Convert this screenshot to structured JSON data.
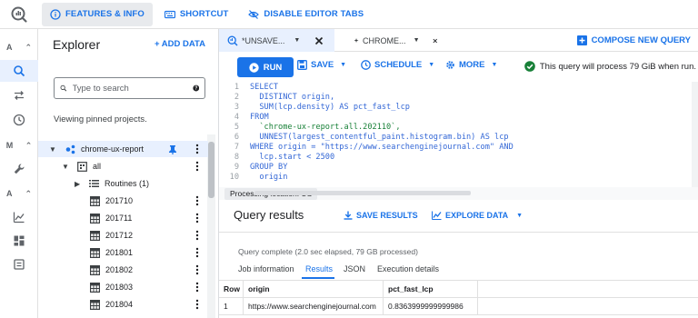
{
  "topbar": {
    "features_label": "FEATURES & INFO",
    "shortcut_label": "SHORTCUT",
    "disable_tabs_label": "DISABLE EDITOR TABS"
  },
  "rail": {
    "rows": [
      {
        "letter": "A",
        "chevron": "^"
      },
      {
        "letter": "M",
        "chevron": "^"
      },
      {
        "letter": "A",
        "chevron": "^"
      }
    ]
  },
  "explorer": {
    "title": "Explorer",
    "add_data_label": "+ ADD DATA",
    "search_placeholder": "Type to search",
    "pinned_text": "Viewing pinned projects.",
    "project": "chrome-ux-report",
    "dataset": "all",
    "routines": "Routines (1)",
    "tables": [
      "201710",
      "201711",
      "201712",
      "201801",
      "201802",
      "201803",
      "201804"
    ]
  },
  "tabs": {
    "tab1_label": "*UNSAVE...",
    "tab2_label": "CHROME...",
    "compose_label": "COMPOSE NEW QUERY"
  },
  "toolbar": {
    "run_label": "RUN",
    "save_label": "SAVE",
    "schedule_label": "SCHEDULE",
    "more_label": "MORE",
    "process_message": "This query will process 79 GiB when run."
  },
  "editor": {
    "lines": [
      {
        "n": "1",
        "text": "SELECT"
      },
      {
        "n": "2",
        "text": "  DISTINCT origin,"
      },
      {
        "n": "3",
        "text": "  SUM(lcp.density) AS pct_fast_lcp"
      },
      {
        "n": "4",
        "text": "FROM"
      },
      {
        "n": "5",
        "text": "  `chrome-ux-report.all.202110`,"
      },
      {
        "n": "6",
        "text": "  UNNEST(largest_contentful_paint.histogram.bin) AS lcp"
      },
      {
        "n": "7",
        "text": "WHERE origin = \"https://www.searchenginejournal.com\" AND"
      },
      {
        "n": "8",
        "text": "  lcp.start < 2500"
      },
      {
        "n": "9",
        "text": "GROUP BY"
      },
      {
        "n": "10",
        "text": "  origin"
      }
    ]
  },
  "location": "Processing location: US",
  "results": {
    "title": "Query results",
    "save_results_label": "SAVE RESULTS",
    "explore_label": "EXPLORE DATA",
    "complete_text": "Query complete (2.0 sec elapsed, 79 GB processed)",
    "tabs": [
      "Job information",
      "Results",
      "JSON",
      "Execution details"
    ],
    "columns": [
      "Row",
      "origin",
      "pct_fast_lcp"
    ],
    "rows": [
      [
        "1",
        "https://www.searchenginejournal.com",
        "0.8363999999999986"
      ]
    ]
  },
  "colors": {
    "accent": "#1a73e8",
    "success": "#188038"
  }
}
